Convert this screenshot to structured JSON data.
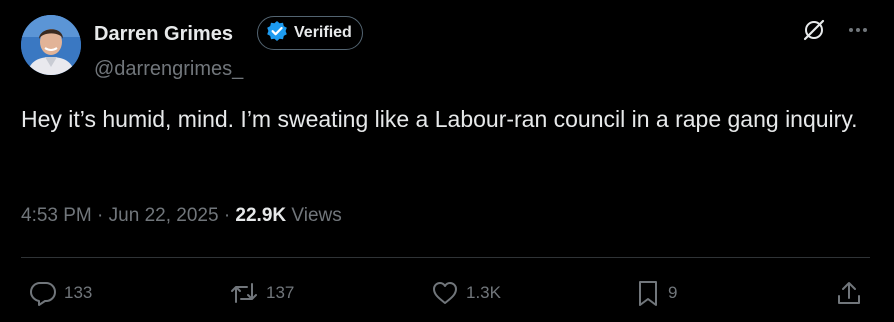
{
  "author": {
    "name": "Darren Grimes",
    "handle": "@darrengrimes_",
    "verified_label": "Verified",
    "verified_color": "#1d9bf0"
  },
  "tweet": {
    "text": "Hey it’s humid, mind. I’m sweating like a Labour-ran council in a rape gang inquiry.",
    "time": "4:53 PM",
    "date": "Jun 22, 2025",
    "views_count": "22.9K",
    "views_label": "Views"
  },
  "actions": {
    "replies": "133",
    "reposts": "137",
    "likes": "1.3K",
    "bookmarks": "9"
  },
  "icons": {
    "grok": "grok-icon",
    "more": "more-icon",
    "reply": "reply-icon",
    "repost": "repost-icon",
    "like": "heart-icon",
    "bookmark": "bookmark-icon",
    "share": "share-icon"
  },
  "colors": {
    "background": "#000000",
    "text": "#e7e9ea",
    "muted": "#71767b",
    "divider": "#2f3336"
  }
}
